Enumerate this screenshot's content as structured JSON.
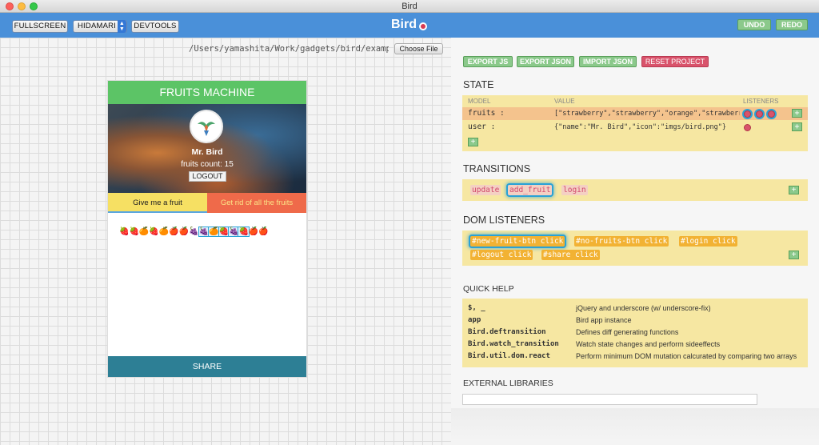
{
  "window": {
    "title": "Bird"
  },
  "toolbar": {
    "fullscreen_label": "FULLSCREEN",
    "theme_value": "HIDAMARI",
    "devtools_label": "DEVTOOLS",
    "app_title": "Bird",
    "undo_label": "UNDO",
    "redo_label": "REDO"
  },
  "file": {
    "path": "/Users/yamashita/Work/gadgets/bird/examples/fruits",
    "choose_label": "Choose File"
  },
  "app": {
    "header": "FRUITS MACHINE",
    "user_name": "Mr. Bird",
    "fruits_count_text": "fruits count: 15",
    "logout_label": "LOGOUT",
    "give_label": "Give me a fruit",
    "rid_label": "Get rid of all the fruits",
    "fruits": [
      "🍓",
      "🍓",
      "🍊",
      "🍓",
      "🍊",
      "🍎",
      "🍎",
      "🍇",
      "🍇",
      "🍊",
      "🍓",
      "🍇",
      "🍓",
      "🍎",
      "🍎"
    ],
    "share_label": "SHARE"
  },
  "controls": {
    "export_js": "EXPORT JS",
    "export_json": "EXPORT JSON",
    "import_json": "IMPORT JSON",
    "reset_project": "RESET PROJECT"
  },
  "state": {
    "title": "STATE",
    "col_model": "MODEL",
    "col_value": "VALUE",
    "col_listeners": "LISTENERS",
    "rows": [
      {
        "model": "fruits :",
        "value": "[\"strawberry\",\"strawberry\",\"orange\",\"strawberry\",\"orange\",\"apple\"]"
      },
      {
        "model": "user :",
        "value": "{\"name\":\"Mr. Bird\",\"icon\":\"imgs/bird.png\"}"
      }
    ],
    "add_label": "+"
  },
  "transitions": {
    "title": "TRANSITIONS",
    "items": [
      "update",
      "add_fruit",
      "login"
    ],
    "add_label": "+"
  },
  "dom_listeners": {
    "title": "DOM LISTENERS",
    "items": [
      "#new-fruit-btn click",
      "#no-fruits-btn click",
      "#login click",
      "#logout click",
      "#share click"
    ],
    "add_label": "+"
  },
  "quick_help": {
    "title": "QUICK HELP",
    "rows": [
      {
        "key": "$, _",
        "desc": "jQuery and underscore (w/ underscore-fix)"
      },
      {
        "key": "app",
        "desc": "Bird app instance"
      },
      {
        "key": "Bird.deftransition",
        "desc": "Defines diff generating functions"
      },
      {
        "key": "Bird.watch_transition",
        "desc": "Watch state changes and perform sideeffects"
      },
      {
        "key": "Bird.util.dom.react",
        "desc": "Perform minimum DOM mutation calcurated by comparing two arrays"
      }
    ]
  },
  "external_libraries": {
    "title": "EXTERNAL LIBRARIES"
  },
  "colors": {
    "toolbar": "#4a90d9",
    "green": "#5cc466",
    "yellow": "#f6e063",
    "red": "#ef6a4a",
    "share": "#2d7f95",
    "panel": "#f6e7a2"
  }
}
